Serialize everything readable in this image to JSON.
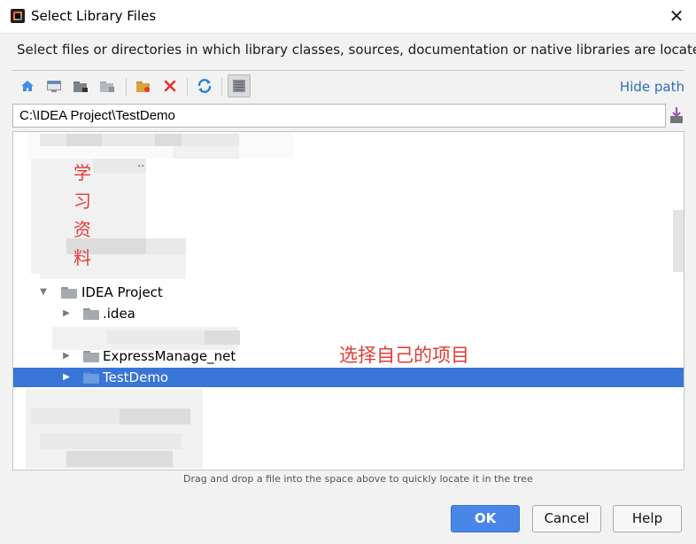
{
  "window": {
    "title": "Select Library Files",
    "close_glyph": "✕"
  },
  "instruction": "Select files or directories in which library classes, sources, documentation or native libraries are located",
  "toolbar": {
    "icons": [
      "home-icon",
      "desktop-icon",
      "project-icon",
      "module-icon",
      "new-folder-icon",
      "delete-icon",
      "refresh-icon",
      "show-hidden-icon"
    ],
    "hide_path_label": "Hide path"
  },
  "path_field": {
    "value": "C:\\IDEA Project\\TestDemo"
  },
  "tree": {
    "rows": [
      {
        "label": "IDEA Project",
        "expanded": true
      },
      {
        "label": ".idea",
        "expanded": false
      },
      {
        "label": "ExpressManage_net",
        "expanded": false
      },
      {
        "label": "TestDemo",
        "expanded": false,
        "selected": true
      }
    ],
    "partial_text": ".."
  },
  "annotations": {
    "vertical_chars": [
      "学",
      "习",
      "资",
      "料"
    ],
    "right_note": "选择自己的项目",
    "color": "#e53935"
  },
  "hint": "Drag and drop a file into the space above to quickly locate it in the tree",
  "buttons": {
    "ok": "OK",
    "cancel": "Cancel",
    "help": "Help"
  },
  "colors": {
    "selection": "#3875d7",
    "link": "#2f6db5",
    "primary_button": "#4a86e8"
  }
}
